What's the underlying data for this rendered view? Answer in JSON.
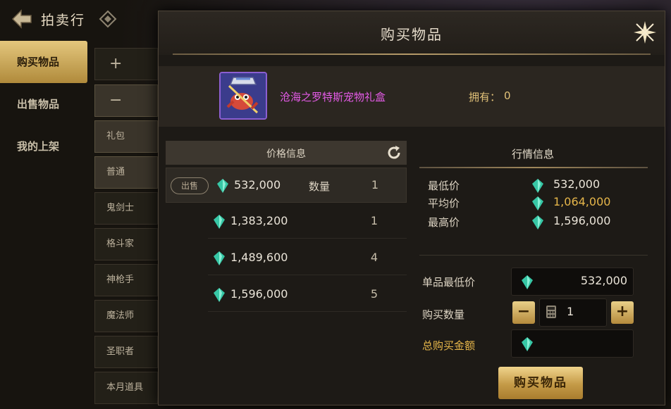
{
  "topbar": {
    "title": "拍卖行"
  },
  "nav": [
    "购买物品",
    "出售物品",
    "我的上架"
  ],
  "class_list": [
    "+",
    "−",
    "礼包",
    "普通",
    "鬼剑士",
    "格斗家",
    "神枪手",
    "魔法师",
    "圣职者",
    "本月道具"
  ],
  "modal": {
    "title": "购买物品",
    "item": {
      "name": "沧海之罗特斯宠物礼盒",
      "owned_label": "拥有：",
      "owned_value": "0"
    },
    "price_panel": {
      "header": "价格信息",
      "sell_badge": "出售",
      "qty_label": "数量",
      "rows": [
        {
          "price": "532,000",
          "qty": "1"
        },
        {
          "price": "1,383,200",
          "qty": "1"
        },
        {
          "price": "1,489,600",
          "qty": "4"
        },
        {
          "price": "1,596,000",
          "qty": "5"
        }
      ]
    },
    "market": {
      "title": "行情信息",
      "min_label": "最低价",
      "min_value": "532,000",
      "avg_label": "平均价",
      "avg_value": "1,064,000",
      "max_label": "最高价",
      "max_value": "1,596,000"
    },
    "form": {
      "unit_min_label": "单品最低价",
      "unit_min_value": "532,000",
      "quantity_label": "购买数量",
      "quantity_value": "1",
      "minus": "−",
      "plus": "+",
      "total_label": "总购买金额",
      "total_value": "",
      "buy_button": "购买物品"
    }
  },
  "colors": {
    "gold": "#e6b64a",
    "item_name": "#e55be8",
    "gem": "#37c7a6"
  }
}
